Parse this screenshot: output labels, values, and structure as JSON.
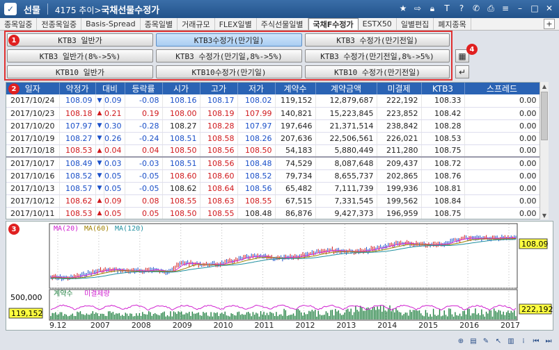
{
  "window": {
    "market_label": "선물",
    "screen_code": "4175 추이>",
    "screen_name": "국채선물수정가",
    "icons": [
      "star-icon",
      "link-icon",
      "lock-icon",
      "text-icon",
      "help-icon",
      "phone-icon",
      "print-icon",
      "menu-icon",
      "minimize-icon",
      "maximize-icon",
      "close-icon"
    ]
  },
  "tabs": [
    "종목일중",
    "전종목일중",
    "Basis-Spread",
    "종목일별",
    "거래규모",
    "FLEX일별",
    "주식선물일별",
    "국채F수정가",
    "ESTX50",
    "일별편집",
    "폐지종목"
  ],
  "active_tab": "국채F수정가",
  "tab_add": "+",
  "badges": [
    "1",
    "2",
    "3",
    "4"
  ],
  "buttons": [
    {
      "label": "KTB3 일반가"
    },
    {
      "label": "KTB3수정가(만기일)",
      "selected": true
    },
    {
      "label": "KTB3 수정가(만기전일)"
    },
    {
      "label": "KTB3 일반가(8%->5%)"
    },
    {
      "label": "KTB3 수정가(만기일,8%->5%)"
    },
    {
      "label": "KTB3 수정가(만기전일,8%->5%)"
    },
    {
      "label": "KTB10 일반가"
    },
    {
      "label": "KTB10수정가(만기일)"
    },
    {
      "label": "KTB10 수정가(만기전일)"
    }
  ],
  "side_buttons": {
    "table": "▦",
    "enter": "↵"
  },
  "table": {
    "columns": [
      "일자",
      "약정가",
      "대비",
      "",
      "등락률",
      "시가",
      "고가",
      "저가",
      "계약수",
      "계약금액",
      "미결제",
      "KTB3",
      "스프레드"
    ],
    "rows": [
      {
        "date": "2017/10/24",
        "price": "108.09",
        "dir": "down",
        "diff": "0.09",
        "rate": "-0.08",
        "open": "108.16",
        "high": "108.17",
        "low": "108.02",
        "qty": "119,152",
        "amt": "12,879,687",
        "oi": "222,192",
        "ktb": "108.33",
        "spread": "0.00",
        "c": {
          "price": "dn",
          "open": "dn",
          "high": "dn",
          "low": "dn",
          "rate": "dn",
          "diff": "dn"
        }
      },
      {
        "date": "2017/10/23",
        "price": "108.18",
        "dir": "up",
        "diff": "0.21",
        "rate": "0.19",
        "open": "108.00",
        "high": "108.19",
        "low": "107.99",
        "qty": "140,821",
        "amt": "15,223,845",
        "oi": "223,852",
        "ktb": "108.42",
        "spread": "0.00",
        "c": {
          "price": "up",
          "open": "up",
          "high": "up",
          "low": "up",
          "rate": "up",
          "diff": "up"
        }
      },
      {
        "date": "2017/10/20",
        "price": "107.97",
        "dir": "down",
        "diff": "0.30",
        "rate": "-0.28",
        "open": "108.27",
        "high": "108.28",
        "low": "107.97",
        "qty": "197,646",
        "amt": "21,371,514",
        "oi": "238,842",
        "ktb": "108.28",
        "spread": "0.00",
        "c": {
          "price": "dn",
          "open": "blk",
          "high": "up",
          "low": "dn",
          "rate": "dn",
          "diff": "dn"
        }
      },
      {
        "date": "2017/10/19",
        "price": "108.27",
        "dir": "down",
        "diff": "0.26",
        "rate": "-0.24",
        "open": "108.51",
        "high": "108.58",
        "low": "108.26",
        "qty": "207,636",
        "amt": "22,506,561",
        "oi": "226,021",
        "ktb": "108.53",
        "spread": "0.00",
        "c": {
          "price": "dn",
          "open": "dn",
          "high": "up",
          "low": "dn",
          "rate": "dn",
          "diff": "dn"
        }
      },
      {
        "date": "2017/10/18",
        "price": "108.53",
        "dir": "up",
        "diff": "0.04",
        "rate": "0.04",
        "open": "108.50",
        "high": "108.56",
        "low": "108.50",
        "qty": "54,183",
        "amt": "5,880,449",
        "oi": "211,280",
        "ktb": "108.75",
        "spread": "0.00",
        "c": {
          "price": "up",
          "open": "up",
          "high": "up",
          "low": "up",
          "rate": "up",
          "diff": "up"
        }
      },
      {
        "date": "2017/10/17",
        "price": "108.49",
        "dir": "down",
        "diff": "0.03",
        "rate": "-0.03",
        "open": "108.51",
        "high": "108.56",
        "low": "108.48",
        "qty": "74,529",
        "amt": "8,087,648",
        "oi": "209,437",
        "ktb": "108.72",
        "spread": "0.00",
        "c": {
          "price": "dn",
          "open": "dn",
          "high": "up",
          "low": "dn",
          "rate": "dn",
          "diff": "dn"
        }
      },
      {
        "date": "2017/10/16",
        "price": "108.52",
        "dir": "down",
        "diff": "0.05",
        "rate": "-0.05",
        "open": "108.60",
        "high": "108.60",
        "low": "108.52",
        "qty": "79,734",
        "amt": "8,655,737",
        "oi": "202,865",
        "ktb": "108.76",
        "spread": "0.00",
        "c": {
          "price": "dn",
          "open": "up",
          "high": "up",
          "low": "dn",
          "rate": "dn",
          "diff": "dn"
        }
      },
      {
        "date": "2017/10/13",
        "price": "108.57",
        "dir": "down",
        "diff": "0.05",
        "rate": "-0.05",
        "open": "108.62",
        "high": "108.64",
        "low": "108.56",
        "qty": "65,482",
        "amt": "7,111,739",
        "oi": "199,936",
        "ktb": "108.81",
        "spread": "0.00",
        "c": {
          "price": "dn",
          "open": "blk",
          "high": "up",
          "low": "dn",
          "rate": "dn",
          "diff": "dn"
        }
      },
      {
        "date": "2017/10/12",
        "price": "108.62",
        "dir": "up",
        "diff": "0.09",
        "rate": "0.08",
        "open": "108.55",
        "high": "108.63",
        "low": "108.55",
        "qty": "67,515",
        "amt": "7,331,545",
        "oi": "199,562",
        "ktb": "108.84",
        "spread": "0.00",
        "c": {
          "price": "up",
          "open": "up",
          "high": "up",
          "low": "up",
          "rate": "up",
          "diff": "up"
        }
      },
      {
        "date": "2017/10/11",
        "price": "108.53",
        "dir": "up",
        "diff": "0.05",
        "rate": "0.05",
        "open": "108.50",
        "high": "108.55",
        "low": "108.48",
        "qty": "86,876",
        "amt": "9,427,373",
        "oi": "196,959",
        "ktb": "108.75",
        "spread": "0.00",
        "c": {
          "price": "up",
          "open": "up",
          "high": "up",
          "low": "blk",
          "rate": "up",
          "diff": "up"
        }
      }
    ]
  },
  "chart": {
    "legend_price": [
      {
        "name": "MA(20)",
        "color": "#d020d0"
      },
      {
        "name": "MA(60)",
        "color": "#a08000"
      },
      {
        "name": "MA(120)",
        "color": "#2090a0"
      }
    ],
    "legend_volume": [
      {
        "name": "계약수",
        "color": "#208040"
      },
      {
        "name": "미결제량",
        "color": "#d020d0"
      }
    ],
    "price_tag": "108.09",
    "volume_axis_label": "500,000",
    "volume_tag": "119,152",
    "oi_tag": "222,192",
    "x_labels": [
      "9.12",
      "2007",
      "2008",
      "2009",
      "2010",
      "2011",
      "2012",
      "2013",
      "2014",
      "2015",
      "2016",
      "2017"
    ]
  },
  "colors": {
    "up": "#d0181c",
    "down": "#1a4fc8",
    "header": "#2a63b4",
    "highlight": "#ffff40"
  },
  "status_icons": [
    "zoom-in-icon",
    "note-icon",
    "comment-icon",
    "cursor-icon",
    "split-icon",
    "vertical-line-icon",
    "first-icon",
    "last-icon"
  ]
}
